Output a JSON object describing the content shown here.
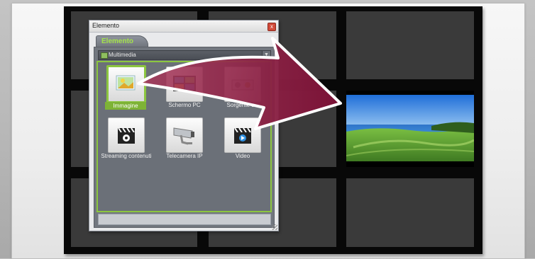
{
  "dialog": {
    "title": "Elemento",
    "close_glyph": "x",
    "tab_label": "Elemento",
    "category_select": {
      "value": "Multimedia",
      "dropdown_glyph": "▼"
    },
    "items": [
      {
        "label": "Immagine",
        "icon": "image-icon",
        "selected": true
      },
      {
        "label": "Schermo PC",
        "icon": "pc-screen-icon",
        "selected": false
      },
      {
        "label": "Sorgente di i",
        "icon": "source-icon",
        "selected": false
      },
      {
        "label": "Streaming contenuti",
        "icon": "film-clapper-icon",
        "selected": false
      },
      {
        "label": "Telecamera IP",
        "icon": "security-camera-icon",
        "selected": false
      },
      {
        "label": "Video",
        "icon": "video-clapper-icon",
        "selected": false
      }
    ]
  },
  "videowall": {
    "cells": 9,
    "image_cell": "landscape-photo"
  },
  "colors": {
    "accent_green": "#8cc63f",
    "arrow": "#8a1a3f",
    "cell": "#3a3a3a",
    "wall_border": "#080808"
  }
}
